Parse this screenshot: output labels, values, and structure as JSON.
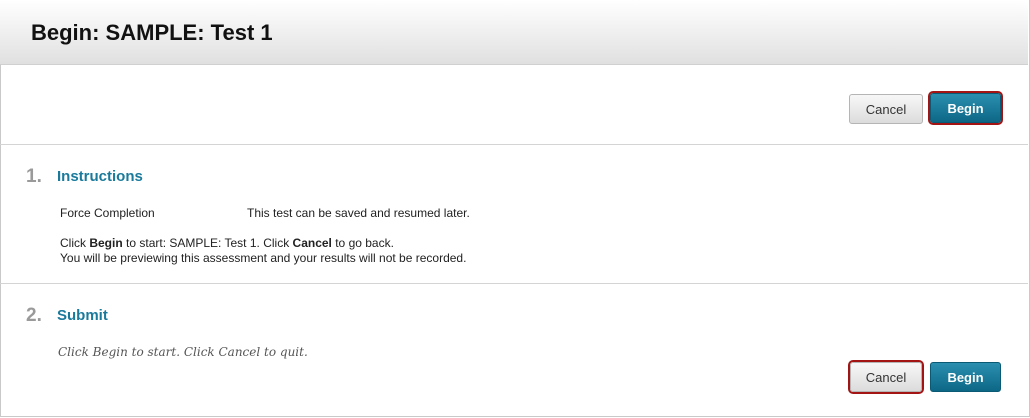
{
  "header": {
    "title": "Begin: SAMPLE: Test 1"
  },
  "top_actions": {
    "cancel_label": "Cancel",
    "begin_label": "Begin"
  },
  "instructions": {
    "number": "1.",
    "title": "Instructions",
    "force_label": "Force Completion",
    "force_value": "This test can be saved and resumed later.",
    "line1_pre": "Click ",
    "line1_begin": "Begin",
    "line1_mid": " to start: SAMPLE: Test 1. Click ",
    "line1_cancel": "Cancel",
    "line1_post": " to go back.",
    "line2": "You will be previewing this assessment and your results will not be recorded."
  },
  "submit": {
    "number": "2.",
    "title": "Submit",
    "note": "Click Begin to start. Click Cancel to quit.",
    "cancel_label": "Cancel",
    "begin_label": "Begin"
  }
}
